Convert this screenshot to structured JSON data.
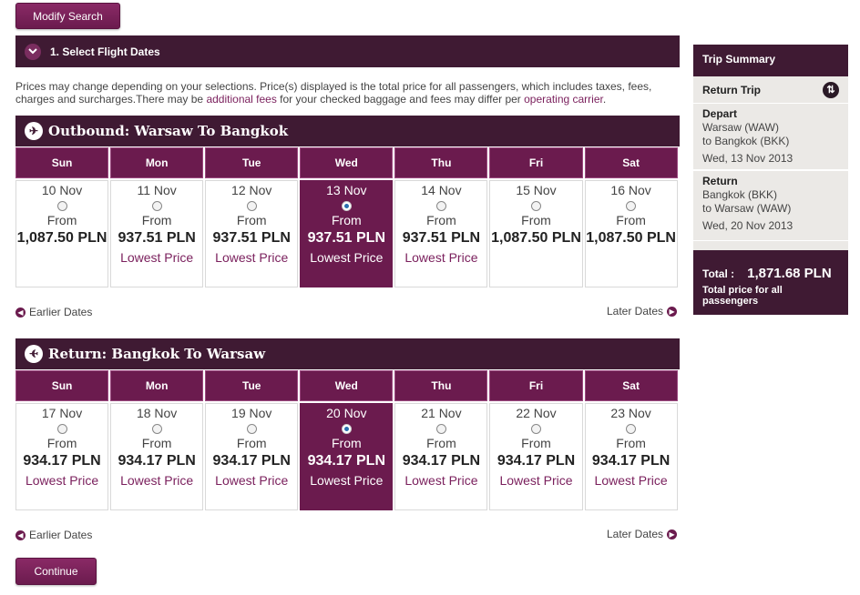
{
  "modify_search_label": "Modify Search",
  "continue_label": "Continue",
  "step": {
    "title": "1. Select Flight Dates"
  },
  "notice": {
    "text1": "Prices may change depending on your selections. Price(s) displayed is the total price for all passengers, which includes taxes, fees, charges and surcharges.There may be ",
    "link1": "additional fees",
    "text2": " for your checked baggage and fees may differ per ",
    "link2": "operating carrier",
    "text3": "."
  },
  "outbound": {
    "title": "Outbound: Warsaw To Bangkok",
    "days": [
      {
        "day": "Sun",
        "date": "10 Nov",
        "from": "From",
        "price": "1,087.50 PLN",
        "lowest": ""
      },
      {
        "day": "Mon",
        "date": "11 Nov",
        "from": "From",
        "price": "937.51 PLN",
        "lowest": "Lowest Price"
      },
      {
        "day": "Tue",
        "date": "12 Nov",
        "from": "From",
        "price": "937.51 PLN",
        "lowest": "Lowest Price"
      },
      {
        "day": "Wed",
        "date": "13 Nov",
        "from": "From",
        "price": "937.51 PLN",
        "lowest": "Lowest Price",
        "selected": true
      },
      {
        "day": "Thu",
        "date": "14 Nov",
        "from": "From",
        "price": "937.51 PLN",
        "lowest": "Lowest Price"
      },
      {
        "day": "Fri",
        "date": "15 Nov",
        "from": "From",
        "price": "1,087.50 PLN",
        "lowest": ""
      },
      {
        "day": "Sat",
        "date": "16 Nov",
        "from": "From",
        "price": "1,087.50 PLN",
        "lowest": ""
      }
    ],
    "earlier": "Earlier Dates",
    "later": "Later Dates"
  },
  "return": {
    "title": "Return: Bangkok To Warsaw",
    "days": [
      {
        "day": "Sun",
        "date": "17 Nov",
        "from": "From",
        "price": "934.17 PLN",
        "lowest": "Lowest Price"
      },
      {
        "day": "Mon",
        "date": "18 Nov",
        "from": "From",
        "price": "934.17 PLN",
        "lowest": "Lowest Price"
      },
      {
        "day": "Tue",
        "date": "19 Nov",
        "from": "From",
        "price": "934.17 PLN",
        "lowest": "Lowest Price"
      },
      {
        "day": "Wed",
        "date": "20 Nov",
        "from": "From",
        "price": "934.17 PLN",
        "lowest": "Lowest Price",
        "selected": true
      },
      {
        "day": "Thu",
        "date": "21 Nov",
        "from": "From",
        "price": "934.17 PLN",
        "lowest": "Lowest Price"
      },
      {
        "day": "Fri",
        "date": "22 Nov",
        "from": "From",
        "price": "934.17 PLN",
        "lowest": "Lowest Price"
      },
      {
        "day": "Sat",
        "date": "23 Nov",
        "from": "From",
        "price": "934.17 PLN",
        "lowest": "Lowest Price"
      }
    ],
    "earlier": "Earlier Dates",
    "later": "Later Dates"
  },
  "summary": {
    "title": "Trip Summary",
    "trip_type": "Return Trip",
    "depart_label": "Depart",
    "depart_from": "Warsaw (WAW)",
    "depart_to": "to Bangkok (BKK)",
    "depart_date": "Wed, 13 Nov 2013",
    "return_label": "Return",
    "return_from": "Bangkok (BKK)",
    "return_to": "to Warsaw (WAW)",
    "return_date": "Wed, 20 Nov 2013",
    "total_label": "Total :",
    "total_amount": "1,871.68  PLN",
    "total_note": "Total price for all passengers"
  },
  "colors": {
    "brand": "#6b1b4e",
    "dark": "#3f1a33"
  }
}
